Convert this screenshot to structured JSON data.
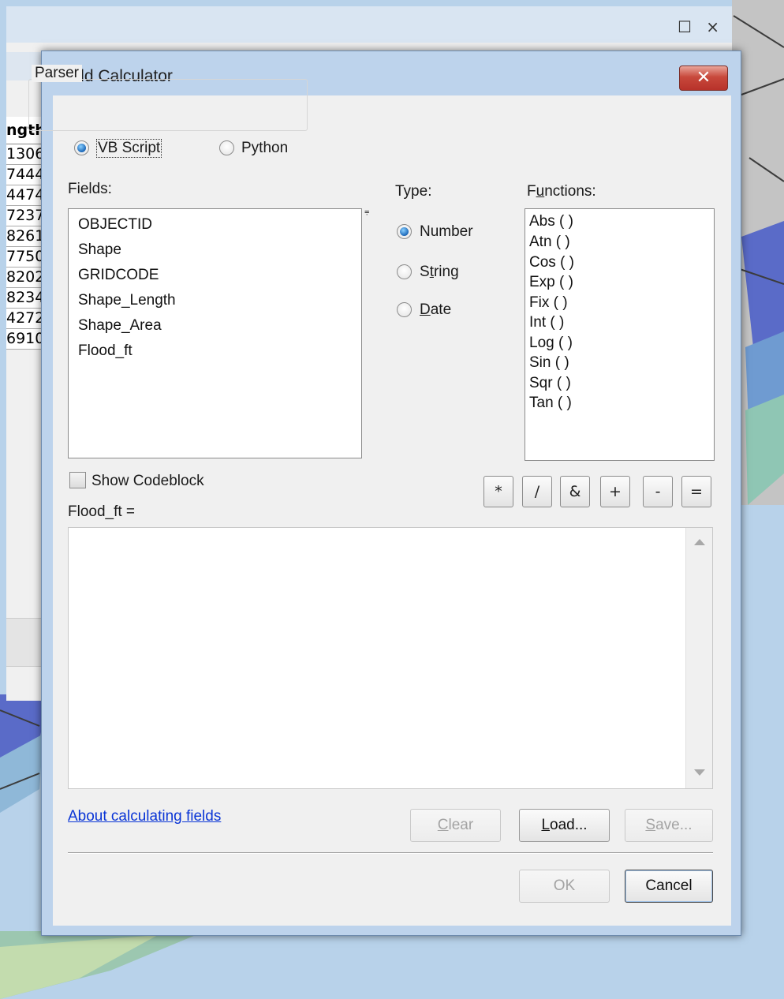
{
  "background_window": {
    "controls": "☐ ×",
    "table": {
      "header": "ngth",
      "rows": [
        "1306",
        "7444",
        "4474",
        "7237",
        "8261",
        "7750",
        "8202",
        "8234",
        "4272",
        "6910"
      ]
    }
  },
  "dialog": {
    "title": "Field Calculator",
    "close_glyph": "✕",
    "parser": {
      "label": "Parser",
      "options": [
        {
          "label": "VB Script",
          "selected": true
        },
        {
          "label": "Python",
          "selected": false
        }
      ]
    },
    "fields": {
      "label": "Fields:",
      "items": [
        "OBJECTID",
        "Shape",
        "GRIDCODE",
        "Shape_Length",
        "Shape_Area",
        "Flood_ft"
      ],
      "sort_glyph": "⩦"
    },
    "type": {
      "label": "Type:",
      "options": [
        {
          "label_pre": "",
          "mnemonic": "",
          "label_post": "Number",
          "selected": true
        },
        {
          "label_pre": "S",
          "mnemonic": "t",
          "label_post": "ring",
          "selected": false
        },
        {
          "label_pre": "",
          "mnemonic": "D",
          "label_post": "ate",
          "selected": false
        }
      ]
    },
    "functions": {
      "label_pre": "F",
      "mnemonic": "u",
      "label_post": "nctions:",
      "items": [
        "Abs (  )",
        "Atn (  )",
        "Cos (  )",
        "Exp (  )",
        "Fix (  )",
        "Int (  )",
        "Log (  )",
        "Sin (  )",
        "Sqr (  )",
        "Tan (  )"
      ]
    },
    "show_codeblock": {
      "label": "Show Codeblock",
      "checked": false
    },
    "operators": [
      "*",
      "/",
      "&",
      "+",
      "-",
      "="
    ],
    "expression": {
      "label": "Flood_ft =",
      "value": ""
    },
    "help_link": "About calculating fields",
    "buttons": {
      "clear": {
        "mnemonic": "C",
        "rest": "lear"
      },
      "load": {
        "mnemonic": "L",
        "rest": "oad..."
      },
      "save": {
        "mnemonic": "S",
        "rest": "ave..."
      },
      "ok": "OK",
      "cancel": "Cancel"
    },
    "colors": {
      "link": "#0a35d6",
      "title_band": "#bdd3ec",
      "close_button": "#c8493c"
    }
  }
}
